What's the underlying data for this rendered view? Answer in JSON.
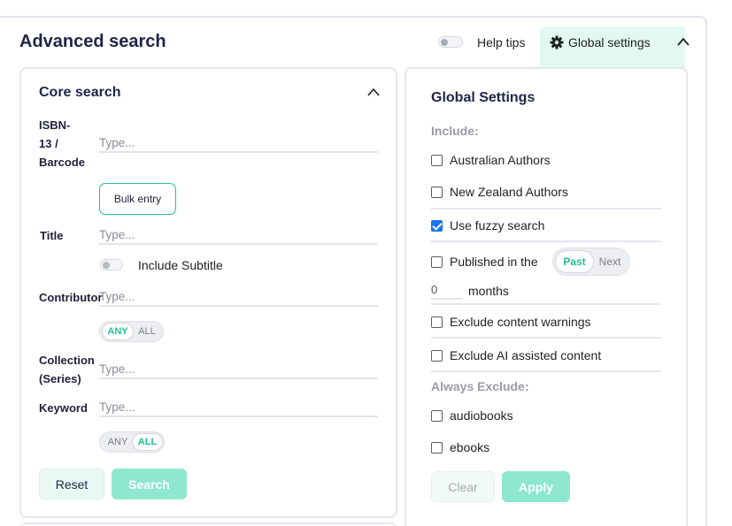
{
  "header": {
    "title": "Advanced search",
    "help_tips_label": "Help tips",
    "help_tips_enabled": false,
    "global_settings_tab": "Global settings",
    "gear_icon": "gear-icon",
    "collapse_icon": "chevron-up-icon"
  },
  "core_search": {
    "title": "Core search",
    "fields": {
      "isbn": {
        "label_lines": [
          "ISBN-",
          "13 /",
          "Barcode"
        ],
        "placeholder": "Type..."
      },
      "bulk_entry": "Bulk entry",
      "title": {
        "label": "Title",
        "placeholder": "Type..."
      },
      "include_subtitle": {
        "label": "Include Subtitle",
        "enabled": false
      },
      "contributor": {
        "label": "Contributor",
        "placeholder": "Type...",
        "match_options": [
          "ANY",
          "ALL"
        ],
        "match_selected": "ANY"
      },
      "collection": {
        "label_lines": [
          "Collection",
          "(Series)"
        ],
        "placeholder": "Type..."
      },
      "keyword": {
        "label": "Keyword",
        "placeholder": "Type...",
        "match_options": [
          "ANY",
          "ALL"
        ],
        "match_selected": "ALL"
      }
    },
    "buttons": {
      "reset": "Reset",
      "search": "Search"
    }
  },
  "global_settings": {
    "title": "Global Settings",
    "include_heading": "Include:",
    "options": [
      {
        "label": "Australian Authors",
        "checked": false
      },
      {
        "label": "New Zealand Authors",
        "checked": false
      },
      {
        "label": "Use fuzzy search",
        "checked": true
      },
      {
        "label": "Published in the",
        "checked": false
      },
      {
        "label": "Exclude content warnings",
        "checked": false
      },
      {
        "label": "Exclude AI assisted content",
        "checked": false
      }
    ],
    "published_toggle": {
      "options": [
        "Past",
        "Next"
      ],
      "selected": "Past"
    },
    "months_value": "0",
    "months_label": "months",
    "always_exclude_heading": "Always Exclude:",
    "exclude_options": [
      {
        "label": "audiobooks",
        "checked": false
      },
      {
        "label": "ebooks",
        "checked": false
      }
    ],
    "buttons": {
      "clear": "Clear",
      "apply": "Apply"
    }
  },
  "colors": {
    "accent": "#21c090",
    "accent_light": "#8de8cd",
    "tab_bg": "#e3f8f2",
    "checkbox_checked": "#1a73e8"
  }
}
